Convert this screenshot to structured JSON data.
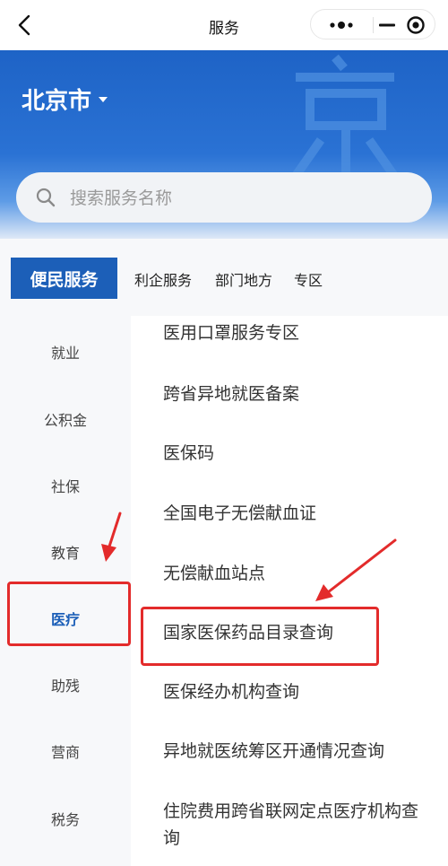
{
  "navbar": {
    "title": "服务",
    "back_icon": "chevron-left-icon",
    "more_icon": "more-dots-icon",
    "minimize_icon": "minimize-icon",
    "close_icon": "target-circle-icon"
  },
  "header": {
    "city": "北京市",
    "city_caret_icon": "caret-down-icon",
    "background_color": "#1e63c6"
  },
  "search": {
    "placeholder": "搜索服务名称",
    "icon": "search-icon"
  },
  "tabs": [
    {
      "label": "便民服务",
      "active": true
    },
    {
      "label": "利企服务",
      "active": false
    },
    {
      "label": "部门地方",
      "active": false
    },
    {
      "label": "专区",
      "active": false
    }
  ],
  "sidebar": {
    "items": [
      {
        "label": "就业",
        "active": false
      },
      {
        "label": "公积金",
        "active": false
      },
      {
        "label": "社保",
        "active": false
      },
      {
        "label": "教育",
        "active": false
      },
      {
        "label": "医疗",
        "active": true
      },
      {
        "label": "助残",
        "active": false
      },
      {
        "label": "营商",
        "active": false
      },
      {
        "label": "税务",
        "active": false
      }
    ]
  },
  "services": {
    "items": [
      {
        "label": "医用口罩服务专区"
      },
      {
        "label": "跨省异地就医备案"
      },
      {
        "label": "医保码"
      },
      {
        "label": "全国电子无偿献血证"
      },
      {
        "label": "无偿献血站点"
      },
      {
        "label": "国家医保药品目录查询",
        "highlighted": true
      },
      {
        "label": "医保经办机构查询"
      },
      {
        "label": "异地就医统筹区开通情况查询"
      },
      {
        "label": "住院费用跨省联网定点医疗机构查询"
      }
    ]
  },
  "colors": {
    "accent": "#1c5fb8",
    "annotation": "#e32b2b"
  }
}
